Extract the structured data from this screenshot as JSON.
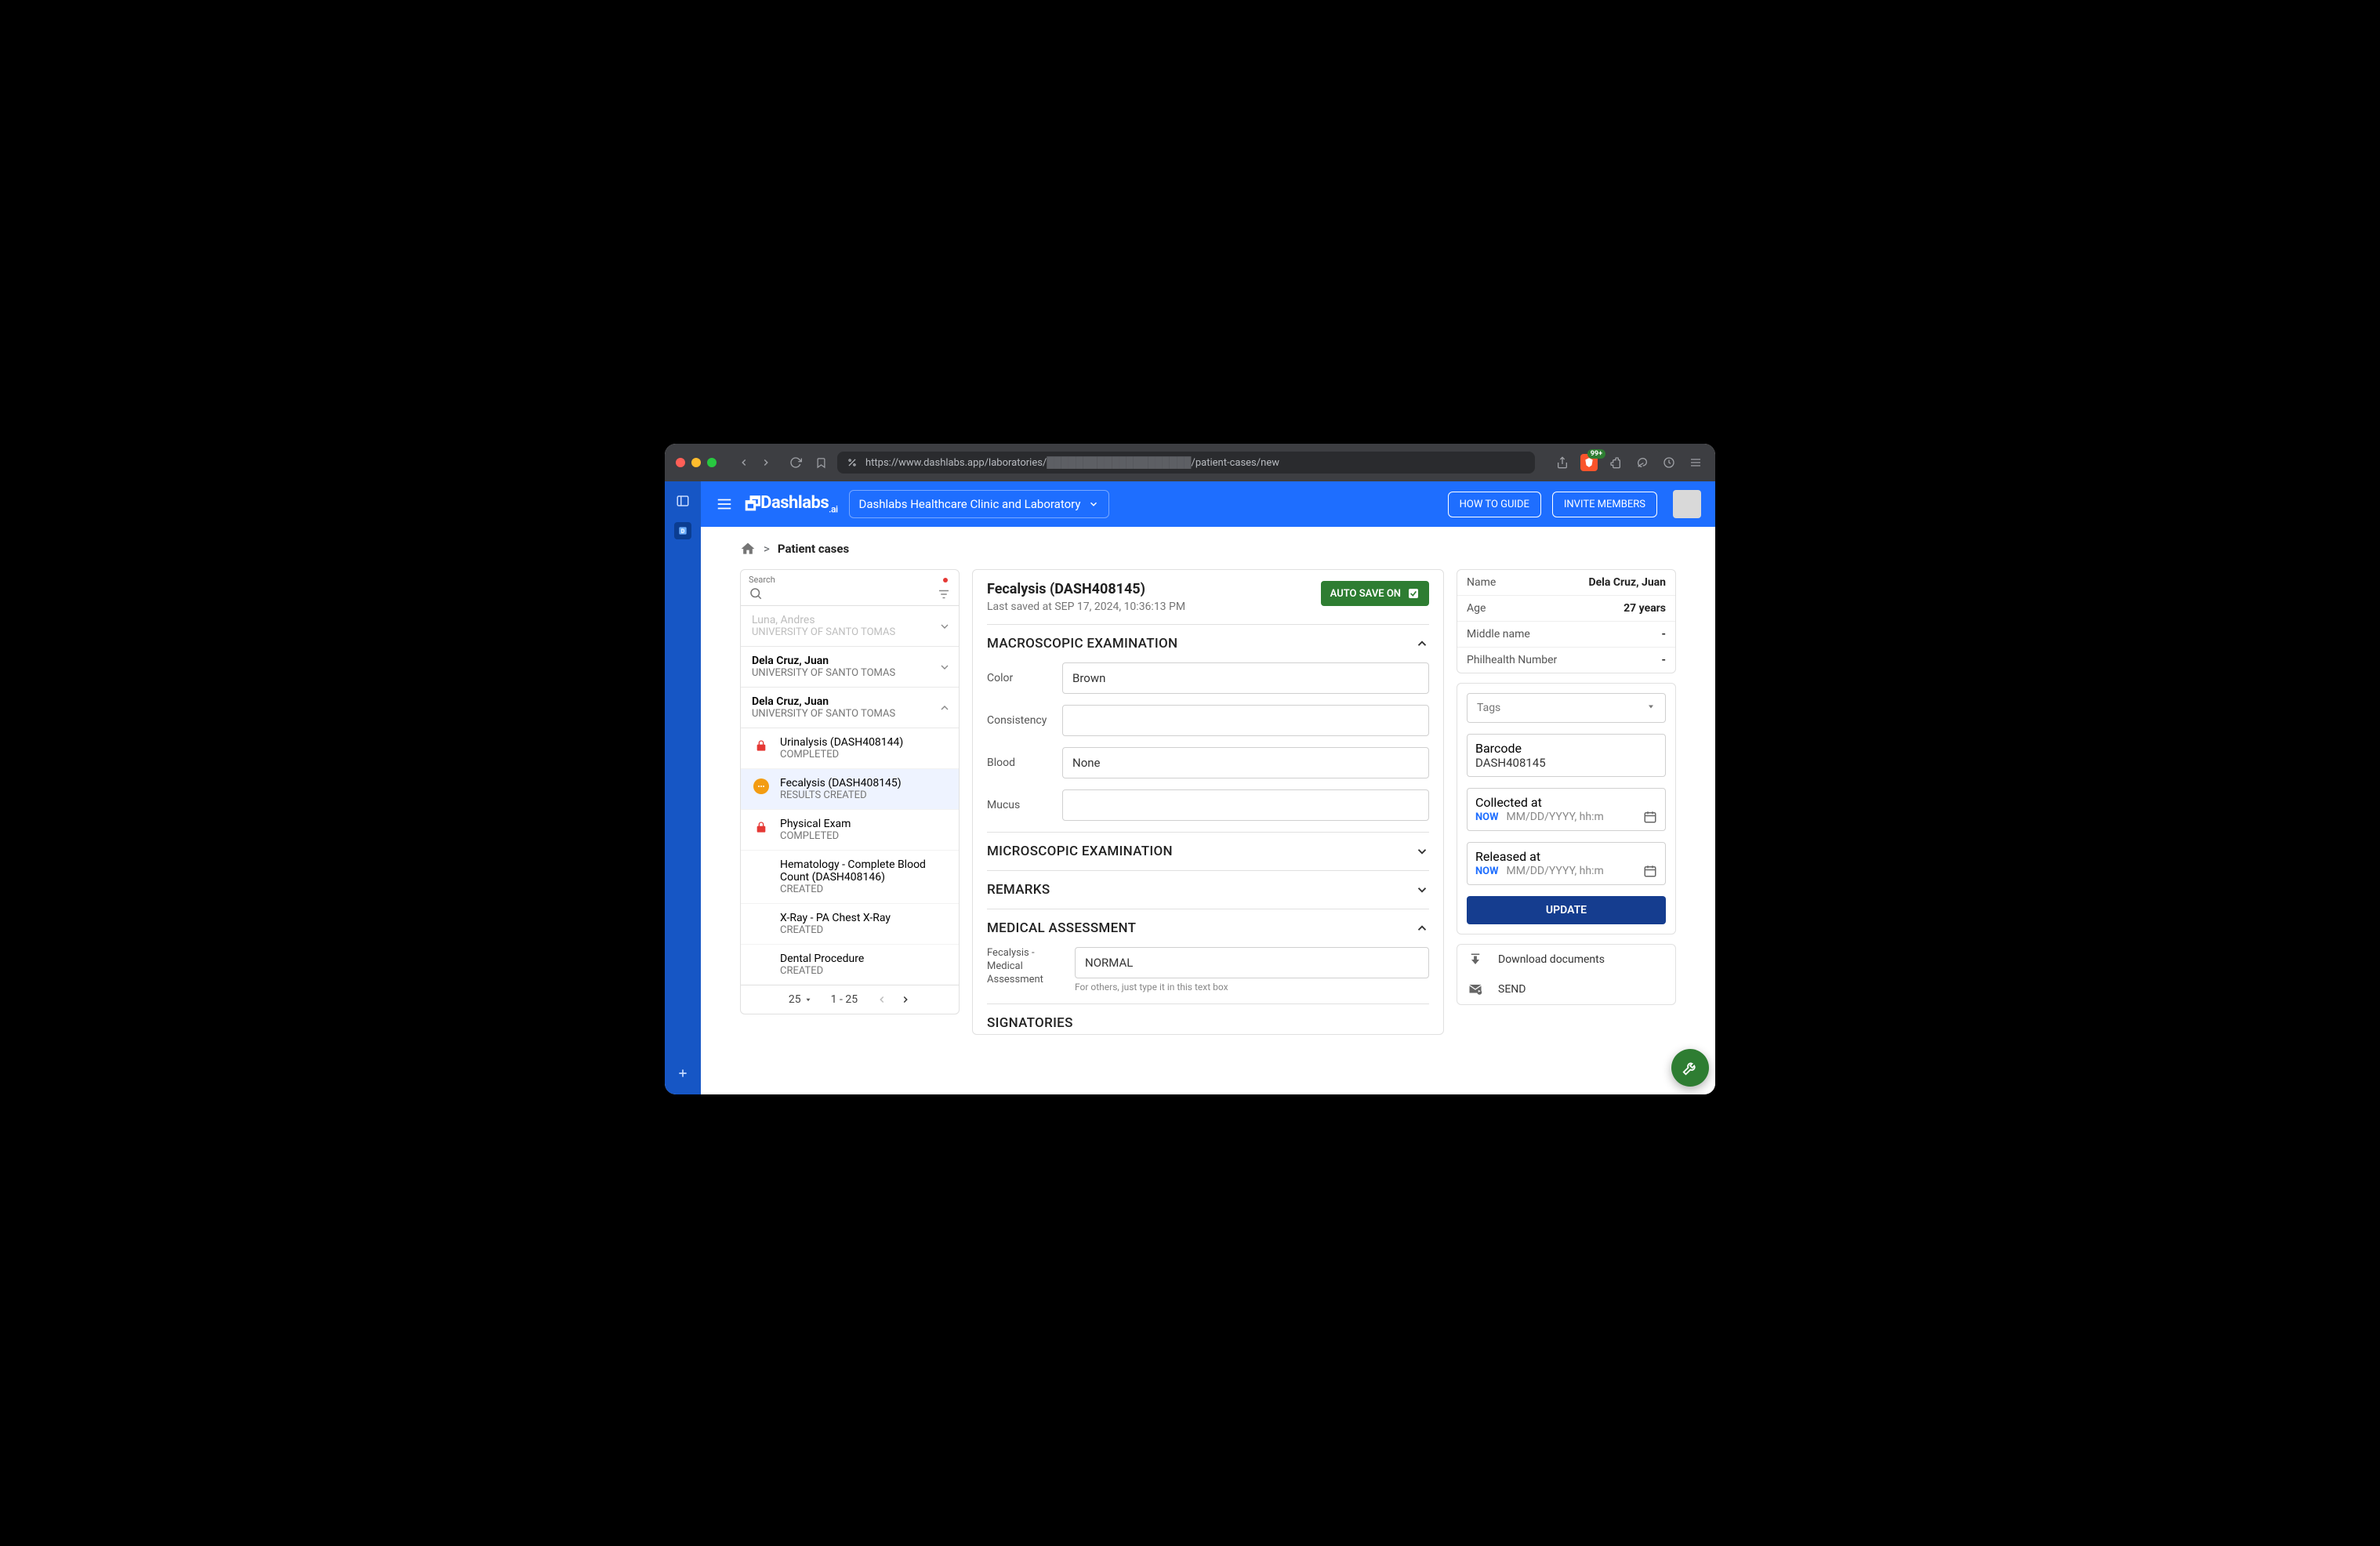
{
  "browser": {
    "url_prefix": "https://www.dashlabs.app/laboratories/",
    "url_suffix": "/patient-cases/new",
    "ext_badge": "99+"
  },
  "header": {
    "logo": "Dashlabs",
    "logo_suffix": ".ai",
    "org_name": "Dashlabs Healthcare Clinic and Laboratory",
    "how_to": "HOW TO GUIDE",
    "invite": "INVITE MEMBERS"
  },
  "breadcrumb": {
    "label": "Patient cases",
    "sep": ">"
  },
  "search": {
    "label": "Search"
  },
  "cases": [
    {
      "name": "Luna, Andres",
      "org": "UNIVERSITY OF SANTO TOMAS",
      "state": "dim",
      "chev": "down"
    },
    {
      "name": "Dela Cruz, Juan",
      "org": "UNIVERSITY OF SANTO TOMAS",
      "state": "normal",
      "chev": "down"
    },
    {
      "name": "Dela Cruz, Juan",
      "org": "UNIVERSITY OF SANTO TOMAS",
      "state": "normal",
      "chev": "up",
      "expanded": true
    }
  ],
  "subitems": [
    {
      "icon": "lock",
      "title": "Urinalysis (DASH408144)",
      "status": "COMPLETED"
    },
    {
      "icon": "dots",
      "title": "Fecalysis (DASH408145)",
      "status": "RESULTS CREATED",
      "active": true
    },
    {
      "icon": "lock",
      "title": "Physical Exam",
      "status": "COMPLETED"
    },
    {
      "icon": "",
      "title": "Hematology - Complete Blood Count (DASH408146)",
      "status": "CREATED"
    },
    {
      "icon": "",
      "title": "X-Ray - PA Chest X-Ray",
      "status": "CREATED"
    },
    {
      "icon": "",
      "title": "Dental Procedure",
      "status": "CREATED"
    }
  ],
  "pager": {
    "page_size": "25",
    "range": "1 - 25"
  },
  "main": {
    "title": "Fecalysis (DASH408145)",
    "last_saved": "Last saved at SEP 17, 2024, 10:36:13 PM",
    "autosave": "AUTO SAVE ON",
    "sections": {
      "macro": "MACROSCOPIC EXAMINATION",
      "micro": "MICROSCOPIC EXAMINATION",
      "remarks": "REMARKS",
      "assessment": "MEDICAL ASSESSMENT",
      "signatories": "SIGNATORIES"
    },
    "fields": {
      "color_label": "Color",
      "color_value": "Brown",
      "consistency_label": "Consistency",
      "consistency_value": "",
      "blood_label": "Blood",
      "blood_value": "None",
      "mucus_label": "Mucus",
      "mucus_value": "",
      "assessment_label": "Fecalysis - Medical Assessment",
      "assessment_value": "NORMAL",
      "assessment_helper": "For others, just type it in this text box"
    }
  },
  "patient": {
    "name_k": "Name",
    "name_v": "Dela Cruz, Juan",
    "age_k": "Age",
    "age_v": "27 years",
    "middle_k": "Middle name",
    "middle_v": "-",
    "phil_k": "Philhealth Number",
    "phil_v": "-"
  },
  "side": {
    "tags": "Tags",
    "barcode_label": "Barcode",
    "barcode_value": "DASH408145",
    "collected_label": "Collected at",
    "released_label": "Released at",
    "now": "NOW",
    "dt_placeholder": "MM/DD/YYYY, hh:m",
    "update": "UPDATE",
    "download": "Download documents",
    "send": "SEND"
  }
}
